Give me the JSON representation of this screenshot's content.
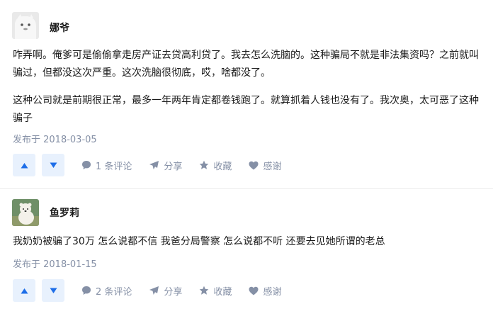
{
  "answers": [
    {
      "author": "娜爷",
      "paragraphs": [
        "咋弄啊。俺爹可是偷偷拿走房产证去贷高利贷了。我去怎么洗脑的。这种骗局不就是非法集资吗？之前就叫骗过，但都没这次严重。这次洗脑很彻底，哎，啥都没了。",
        "这种公司就是前期很正常，最多一年两年肯定都卷钱跑了。就算抓着人钱也没有了。我次奥，太可恶了这种骗子"
      ],
      "date": "发布于 2018-03-05",
      "comments": "1 条评论",
      "share": "分享",
      "collect": "收藏",
      "thanks": "感谢"
    },
    {
      "author": "鱼罗莉",
      "paragraphs": [
        "我奶奶被骗了30万 怎么说都不信 我爸分局警察 怎么说都不听 还要去见她所谓的老总"
      ],
      "date": "发布于 2018-01-15",
      "comments": "2 条评论",
      "share": "分享",
      "collect": "收藏",
      "thanks": "感谢"
    }
  ],
  "icons": {
    "upvote": "triangle-up-icon",
    "downvote": "triangle-down-icon",
    "comment": "speech-bubble-icon",
    "share": "paper-plane-icon",
    "collect": "star-icon",
    "thanks": "heart-icon"
  },
  "colors": {
    "vote_bg": "#e8f1fd",
    "vote_arrow": "#1e6ee8",
    "meta_gray": "#8590a6",
    "text": "#1a1a1a"
  }
}
